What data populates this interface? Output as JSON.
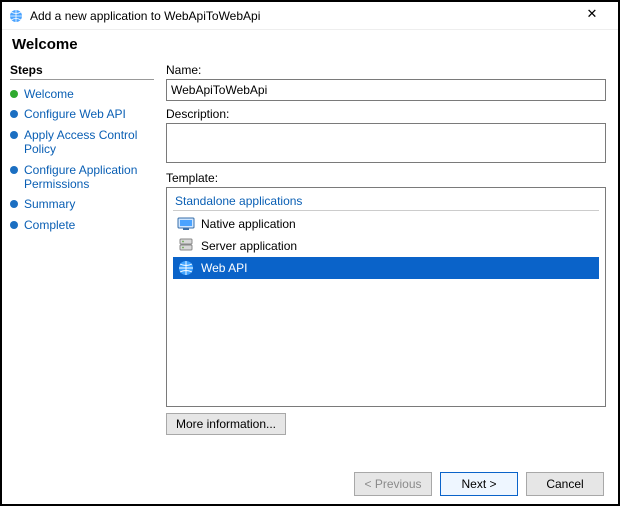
{
  "window": {
    "title": "Add a new application to WebApiToWebApi",
    "close_symbol": "✕"
  },
  "header": "Welcome",
  "sidebar": {
    "title": "Steps",
    "items": [
      {
        "label": "Welcome"
      },
      {
        "label": "Configure Web API"
      },
      {
        "label": "Apply Access Control Policy"
      },
      {
        "label": "Configure Application Permissions"
      },
      {
        "label": "Summary"
      },
      {
        "label": "Complete"
      }
    ]
  },
  "main": {
    "name_label": "Name:",
    "name_value": "WebApiToWebApi",
    "description_label": "Description:",
    "description_value": "",
    "template_label": "Template:",
    "template_group": "Standalone applications",
    "templates": [
      {
        "label": "Native application",
        "icon": "native-app-icon"
      },
      {
        "label": "Server application",
        "icon": "server-app-icon"
      },
      {
        "label": "Web API",
        "icon": "web-api-icon"
      }
    ],
    "more_info": "More information..."
  },
  "footer": {
    "previous": "< Previous",
    "next": "Next >",
    "cancel": "Cancel"
  }
}
